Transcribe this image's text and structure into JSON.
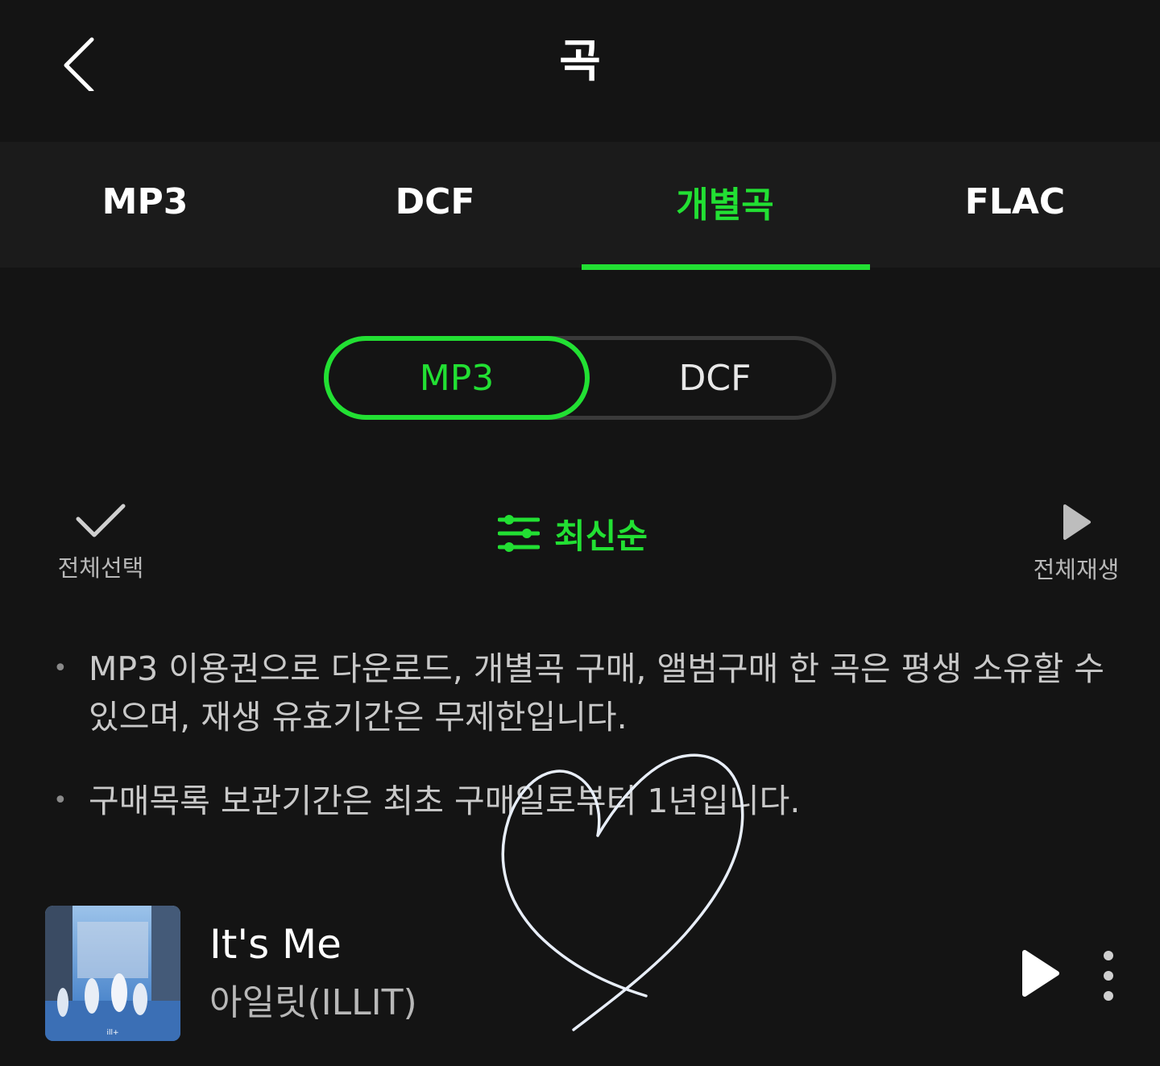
{
  "header": {
    "title": "곡",
    "back_icon": "chevron-left-icon"
  },
  "tabs": [
    {
      "label": "MP3",
      "active": false
    },
    {
      "label": "DCF",
      "active": false
    },
    {
      "label": "개별곡",
      "active": true
    },
    {
      "label": "FLAC",
      "active": false
    }
  ],
  "format_toggle": {
    "options": [
      {
        "label": "MP3",
        "selected": true
      },
      {
        "label": "DCF",
        "selected": false
      }
    ]
  },
  "controls": {
    "select_all_label": "전체선택",
    "sort_label": "최신순",
    "play_all_label": "전체재생"
  },
  "notices": [
    "MP3 이용권으로 다운로드, 개별곡 구매, 앨범구매 한 곡은 평생 소유할 수 있으며, 재생 유효기간은 무제한입니다.",
    "구매목록 보관기간은 최초 구매일로부터 1년입니다."
  ],
  "track": {
    "title": "It's Me",
    "artist": "아일릿(ILLIT)",
    "cover_text": "ill+"
  },
  "colors": {
    "accent": "#22e033",
    "background": "#141414",
    "tab_bar": "#1b1b1b",
    "doodle_stroke": "#e8eef8"
  }
}
